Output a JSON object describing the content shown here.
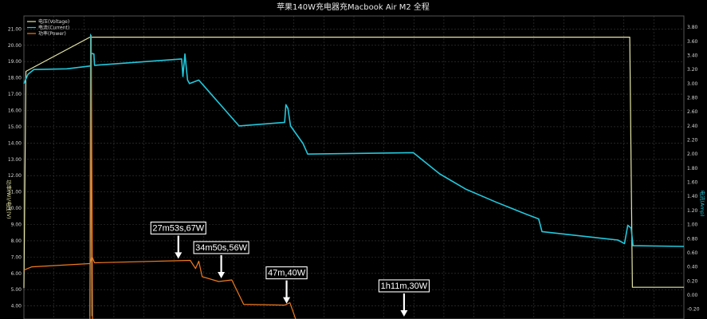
{
  "chart_data": {
    "type": "line",
    "title": "苹果140W充电器充Macbook Air M2 全程",
    "ylabel_left": "功率(W)/电压(V)",
    "ylabel_right": "电流(Amp)",
    "left_ticks": [
      "21.00",
      "20.00",
      "19.00",
      "18.00",
      "17.00",
      "16.00",
      "15.00",
      "14.00",
      "13.00",
      "12.00",
      "11.00",
      "10.00",
      "9.00",
      "8.00",
      "7.00",
      "6.00",
      "5.00",
      "4.00"
    ],
    "right_ticks": [
      "3.80",
      "3.60",
      "3.40",
      "3.20",
      "3.00",
      "2.80",
      "2.60",
      "2.40",
      "2.20",
      "2.00",
      "1.80",
      "1.60",
      "1.40",
      "1.20",
      "1.00",
      "0.80",
      "0.60",
      "0.40",
      "0.20",
      "0.00",
      "-0.20"
    ],
    "ylim_left": [
      3.2,
      21.8
    ],
    "ylim_right": [
      -0.34,
      3.96
    ],
    "xlim": [
      0,
      100
    ],
    "grid": true,
    "legend_position": "top-left",
    "colors": {
      "voltage": "#e6e6a8",
      "current": "#22c8dc",
      "power": "#f07a20",
      "background": "#000000",
      "grid": "#3a3a3a"
    },
    "legend": [
      {
        "name": "电压(Voltage)",
        "color": "#e6e6a8"
      },
      {
        "name": "电流(Current)",
        "color": "#22c8dc"
      },
      {
        "name": "功率(Power)",
        "color": "#f07a20"
      }
    ],
    "series": [
      {
        "key": "voltage",
        "name": "电压(Voltage)",
        "axis": "left",
        "points": [
          [
            0,
            5.1
          ],
          [
            0.3,
            18.4
          ],
          [
            10.0,
            20.5
          ],
          [
            10.4,
            20.5
          ],
          [
            91.8,
            20.5
          ],
          [
            92.2,
            5.15
          ],
          [
            100,
            5.15
          ]
        ]
      },
      {
        "key": "current",
        "name": "电流(Current)",
        "axis": "right",
        "points": [
          [
            0,
            3.0
          ],
          [
            0.6,
            3.13
          ],
          [
            1.5,
            3.2
          ],
          [
            6.5,
            3.21
          ],
          [
            10.1,
            3.25
          ],
          [
            10.2,
            3.43
          ],
          [
            10.6,
            3.42
          ],
          [
            10.7,
            3.26
          ],
          [
            23.9,
            3.35
          ],
          [
            24.1,
            3.1
          ],
          [
            24.4,
            3.42
          ],
          [
            24.8,
            3.05
          ],
          [
            25.1,
            3.0
          ],
          [
            26.5,
            3.05
          ],
          [
            32.6,
            2.4
          ],
          [
            39.5,
            2.45
          ],
          [
            39.7,
            2.7
          ],
          [
            40.0,
            2.65
          ],
          [
            40.4,
            2.4
          ],
          [
            42.3,
            2.15
          ],
          [
            43.0,
            2.0
          ],
          [
            59.0,
            2.02
          ],
          [
            63.0,
            1.72
          ],
          [
            67.0,
            1.5
          ],
          [
            71.5,
            1.32
          ],
          [
            76.0,
            1.15
          ],
          [
            78.0,
            1.08
          ],
          [
            78.5,
            0.9
          ],
          [
            90.0,
            0.78
          ],
          [
            91.0,
            0.73
          ],
          [
            91.5,
            0.99
          ],
          [
            92.0,
            0.95
          ],
          [
            92.3,
            0.7
          ],
          [
            100,
            0.69
          ]
        ]
      },
      {
        "key": "power",
        "name": "功率(Power)",
        "axis": "left",
        "points": [
          [
            0,
            6.2
          ],
          [
            1.2,
            6.4
          ],
          [
            10.0,
            6.6
          ],
          [
            10.3,
            7.05
          ],
          [
            10.7,
            6.65
          ],
          [
            25.2,
            6.8
          ],
          [
            26.0,
            6.3
          ],
          [
            26.5,
            6.75
          ],
          [
            27.0,
            5.8
          ],
          [
            29.5,
            5.5
          ],
          [
            31.5,
            5.6
          ],
          [
            33.3,
            4.1
          ],
          [
            39.5,
            4.05
          ],
          [
            40.3,
            4.2
          ],
          [
            41.0,
            3.4
          ],
          [
            41.5,
            2.8
          ]
        ]
      },
      {
        "key": "current-spike",
        "name": "",
        "axis": "right",
        "points": [
          [
            10.0,
            -0.3
          ],
          [
            10.1,
            3.7
          ],
          [
            10.3,
            -0.3
          ]
        ]
      },
      {
        "key": "power-spike",
        "name": "",
        "axis": "left",
        "points": [
          [
            10.0,
            3.0
          ],
          [
            10.2,
            20.6
          ],
          [
            10.4,
            3.0
          ]
        ]
      }
    ],
    "annotations": [
      {
        "label": "27m53s,67W",
        "x": 23.4,
        "y": 6.85,
        "dir": "down"
      },
      {
        "label": "34m50s,56W",
        "x": 29.9,
        "y": 5.65,
        "dir": "down"
      },
      {
        "label": "47m,40W",
        "x": 39.8,
        "y": 4.1,
        "dir": "down"
      },
      {
        "label": "1h11m,30W",
        "x": 57.6,
        "y": 3.3,
        "dir": "down"
      }
    ]
  }
}
